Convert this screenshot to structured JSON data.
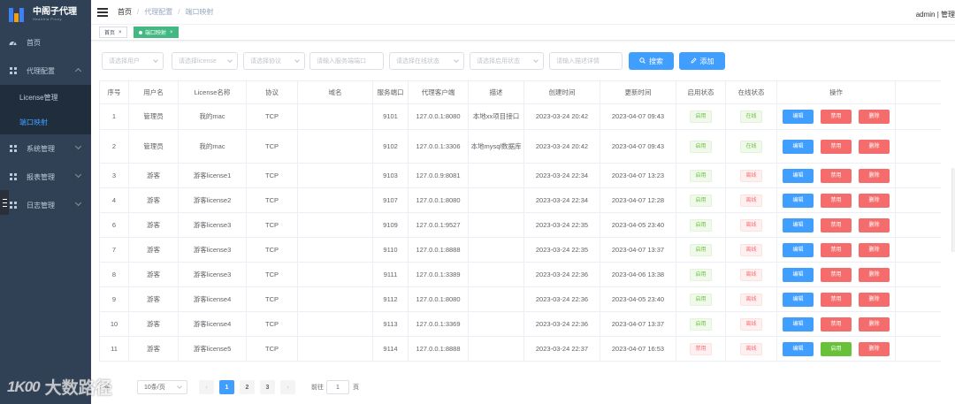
{
  "brand": {
    "name": "中阁子代理",
    "sub": "Healthia Proxy"
  },
  "sidebar": {
    "items": [
      {
        "label": "首页"
      },
      {
        "label": "代理配置"
      },
      {
        "label": "License管理"
      },
      {
        "label": "端口映射"
      },
      {
        "label": "系统管理"
      },
      {
        "label": "报表管理"
      },
      {
        "label": "日志管理"
      }
    ]
  },
  "header": {
    "breadcrumb": [
      "首页",
      "代理配置",
      "端口映射"
    ],
    "user": "admin | 管理"
  },
  "tabs": [
    {
      "label": "首页"
    },
    {
      "label": "端口映射"
    }
  ],
  "filters": {
    "user": "请选择用户",
    "license": "请选择license",
    "protocol": "请选择协议",
    "port": "请输入服务端端口",
    "online": "请选择在线状态",
    "enabled": "请选择启用状态",
    "desc": "请输入描述详情",
    "search_label": "搜索",
    "add_label": "添加"
  },
  "table": {
    "headers": [
      "序号",
      "用户名",
      "License名称",
      "协议",
      "域名",
      "服务端口",
      "代理客户端",
      "描述",
      "创建时间",
      "更新时间",
      "启用状态",
      "在线状态",
      "操作"
    ],
    "rows": [
      {
        "no": "1",
        "user": "管理员",
        "license": "我的mac",
        "protocol": "TCP",
        "domain": "",
        "port": "9101",
        "client": "127.0.0.1:8080",
        "desc": "本地xx项目接口",
        "created": "2023-03-24 20:42",
        "updated": "2023-04-07 09:43",
        "enabled": "启用",
        "online": "在线",
        "op2": "禁用"
      },
      {
        "no": "2",
        "user": "管理员",
        "license": "我的mac",
        "protocol": "TCP",
        "domain": "",
        "port": "9102",
        "client": "127.0.0.1:3306",
        "desc": "本地mysql数据库",
        "created": "2023-03-24 20:42",
        "updated": "2023-04-07 09:43",
        "enabled": "启用",
        "online": "在线",
        "op2": "禁用"
      },
      {
        "no": "3",
        "user": "游客",
        "license": "游客license1",
        "protocol": "TCP",
        "domain": "",
        "port": "9103",
        "client": "127.0.0.9:8081",
        "desc": "",
        "created": "2023-03-24 22:34",
        "updated": "2023-04-07 13:23",
        "enabled": "启用",
        "online": "离线",
        "op2": "禁用"
      },
      {
        "no": "4",
        "user": "游客",
        "license": "游客license2",
        "protocol": "TCP",
        "domain": "",
        "port": "9107",
        "client": "127.0.0.1:8080",
        "desc": "",
        "created": "2023-03-24 22:34",
        "updated": "2023-04-07 12:28",
        "enabled": "启用",
        "online": "离线",
        "op2": "禁用"
      },
      {
        "no": "6",
        "user": "游客",
        "license": "游客license3",
        "protocol": "TCP",
        "domain": "",
        "port": "9109",
        "client": "127.0.0.1:9527",
        "desc": "",
        "created": "2023-03-24 22:35",
        "updated": "2023-04-05 23:40",
        "enabled": "启用",
        "online": "离线",
        "op2": "禁用"
      },
      {
        "no": "7",
        "user": "游客",
        "license": "游客license3",
        "protocol": "TCP",
        "domain": "",
        "port": "9110",
        "client": "127.0.0.1:8888",
        "desc": "",
        "created": "2023-03-24 22:35",
        "updated": "2023-04-07 13:37",
        "enabled": "启用",
        "online": "离线",
        "op2": "禁用"
      },
      {
        "no": "8",
        "user": "游客",
        "license": "游客license3",
        "protocol": "TCP",
        "domain": "",
        "port": "9111",
        "client": "127.0.0.1:3389",
        "desc": "",
        "created": "2023-03-24 22:36",
        "updated": "2023-04-06 13:38",
        "enabled": "启用",
        "online": "离线",
        "op2": "禁用"
      },
      {
        "no": "9",
        "user": "游客",
        "license": "游客license4",
        "protocol": "TCP",
        "domain": "",
        "port": "9112",
        "client": "127.0.0.1:8080",
        "desc": "",
        "created": "2023-03-24 22:36",
        "updated": "2023-04-05 23:40",
        "enabled": "启用",
        "online": "离线",
        "op2": "禁用"
      },
      {
        "no": "10",
        "user": "游客",
        "license": "游客license4",
        "protocol": "TCP",
        "domain": "",
        "port": "9113",
        "client": "127.0.0.1:3369",
        "desc": "",
        "created": "2023-03-24 22:36",
        "updated": "2023-04-07 13:37",
        "enabled": "启用",
        "online": "离线",
        "op2": "禁用"
      },
      {
        "no": "11",
        "user": "游客",
        "license": "游客license5",
        "protocol": "TCP",
        "domain": "",
        "port": "9114",
        "client": "127.0.0.1:8888",
        "desc": "",
        "created": "2023-03-24 22:37",
        "updated": "2023-04-07 16:53",
        "enabled": "禁用",
        "online": "离线",
        "op2": "启用"
      }
    ],
    "op_edit": "编辑",
    "op_delete": "删除"
  },
  "pagination": {
    "total_suffix": "条",
    "page_size": "10条/页",
    "pages": [
      "1",
      "2",
      "3"
    ],
    "current": "1",
    "goto_prefix": "前往",
    "goto_value": "1",
    "goto_suffix": "页"
  },
  "watermark": {
    "logo": "1K00",
    "text": "大数路径"
  },
  "colors": {
    "sidebar": "#304156",
    "primary": "#409eff",
    "success": "#67c23a",
    "danger": "#f56c6c",
    "tag_active": "#42b983"
  }
}
